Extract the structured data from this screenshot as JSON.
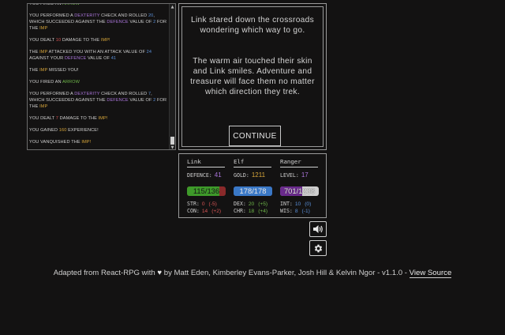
{
  "log": {
    "entries": [
      [
        {
          "t": "You fired an "
        },
        {
          "t": "Arrow",
          "c": "green"
        }
      ],
      [
        {
          "t": "You performed a "
        },
        {
          "t": "Dexterity",
          "c": "purple"
        },
        {
          "t": " check and rolled "
        },
        {
          "t": "20",
          "c": "blue"
        },
        {
          "t": ", which succeeded against the "
        },
        {
          "t": "Defence",
          "c": "purple"
        },
        {
          "t": " value of "
        },
        {
          "t": "2",
          "c": "blue"
        },
        {
          "t": " for the "
        },
        {
          "t": "imp",
          "c": "gold"
        }
      ],
      [
        {
          "t": "You dealt "
        },
        {
          "t": "10",
          "c": "red"
        },
        {
          "t": " damage to the "
        },
        {
          "t": "imp!",
          "c": "gold"
        }
      ],
      [
        {
          "t": "The "
        },
        {
          "t": "imp",
          "c": "gold"
        },
        {
          "t": " attacked you with an attack value of "
        },
        {
          "t": "24",
          "c": "blue"
        },
        {
          "t": " against your "
        },
        {
          "t": "Defence",
          "c": "purple"
        },
        {
          "t": " value of "
        },
        {
          "t": "41",
          "c": "blue"
        }
      ],
      [
        {
          "t": "The "
        },
        {
          "t": "imp",
          "c": "gold"
        },
        {
          "t": " missed you!"
        }
      ],
      [
        {
          "t": "You fired an "
        },
        {
          "t": "Arrow",
          "c": "green"
        }
      ],
      [
        {
          "t": "You performed a "
        },
        {
          "t": "Dexterity",
          "c": "purple"
        },
        {
          "t": " check and rolled "
        },
        {
          "t": "7",
          "c": "blue"
        },
        {
          "t": ", which succeeded against the "
        },
        {
          "t": "Defence",
          "c": "purple"
        },
        {
          "t": " value of "
        },
        {
          "t": "2",
          "c": "blue"
        },
        {
          "t": " for the "
        },
        {
          "t": "imp",
          "c": "gold"
        }
      ],
      [
        {
          "t": "You dealt "
        },
        {
          "t": "7",
          "c": "red"
        },
        {
          "t": " damage to the "
        },
        {
          "t": "imp!",
          "c": "gold"
        }
      ],
      [
        {
          "t": "You gained "
        },
        {
          "t": "160",
          "c": "gold"
        },
        {
          "t": " experience!"
        }
      ],
      [
        {
          "t": "You vanquished the "
        },
        {
          "t": "imp!",
          "c": "gold"
        }
      ]
    ],
    "scroll_up_glyph": "▲",
    "scroll_down_glyph": "▼"
  },
  "story": {
    "paragraph_1": "Link stared down the crossroads wondering which way to go.",
    "paragraph_2": "The warm air touched their skin and Link smiles. Adventure and treasure will face them no matter which direction they trek.",
    "continue_label": "CONTINUE"
  },
  "character": {
    "name": "Link",
    "race": "Elf",
    "class": "Ranger",
    "defence_label": "DEFENCE:",
    "defence": "41",
    "gold_label": "GOLD:",
    "gold": "1211",
    "level_label": "LEVEL:",
    "level": "17",
    "hp": {
      "label": "115/136",
      "fraction": 0.846
    },
    "mp": {
      "label": "178/178",
      "fraction": 1.0
    },
    "xp": {
      "label": "701/1238",
      "fraction": 0.566
    },
    "str_label": "STR:",
    "str": "0",
    "str_mod": "(-5)",
    "con_label": "CON:",
    "con": "14",
    "con_mod": "(+2)",
    "dex_label": "DEX:",
    "dex": "20",
    "dex_mod": "(+5)",
    "chr_label": "CHR:",
    "chr": "18",
    "chr_mod": "(+4)",
    "int_label": "INT:",
    "int": "10",
    "int_mod": "(0)",
    "wis_label": "WIS:",
    "wis": "8",
    "wis_mod": "(-1)"
  },
  "footer": {
    "prefix": "Adapted from React-RPG with ",
    "heart": "♥",
    "credits": " by Matt Eden, Kimberley Evans-Parker, Josh Hill & Kelvin Ngor - v1.1.0 - ",
    "link": "View Source"
  },
  "colors": {
    "gold": "#d6a53a",
    "purple": "#a974d8",
    "blue": "#5a8fd8",
    "red": "#d75454",
    "green": "#6fb84a"
  },
  "icons": {
    "sound": "speaker-icon",
    "settings": "gear-icon"
  }
}
